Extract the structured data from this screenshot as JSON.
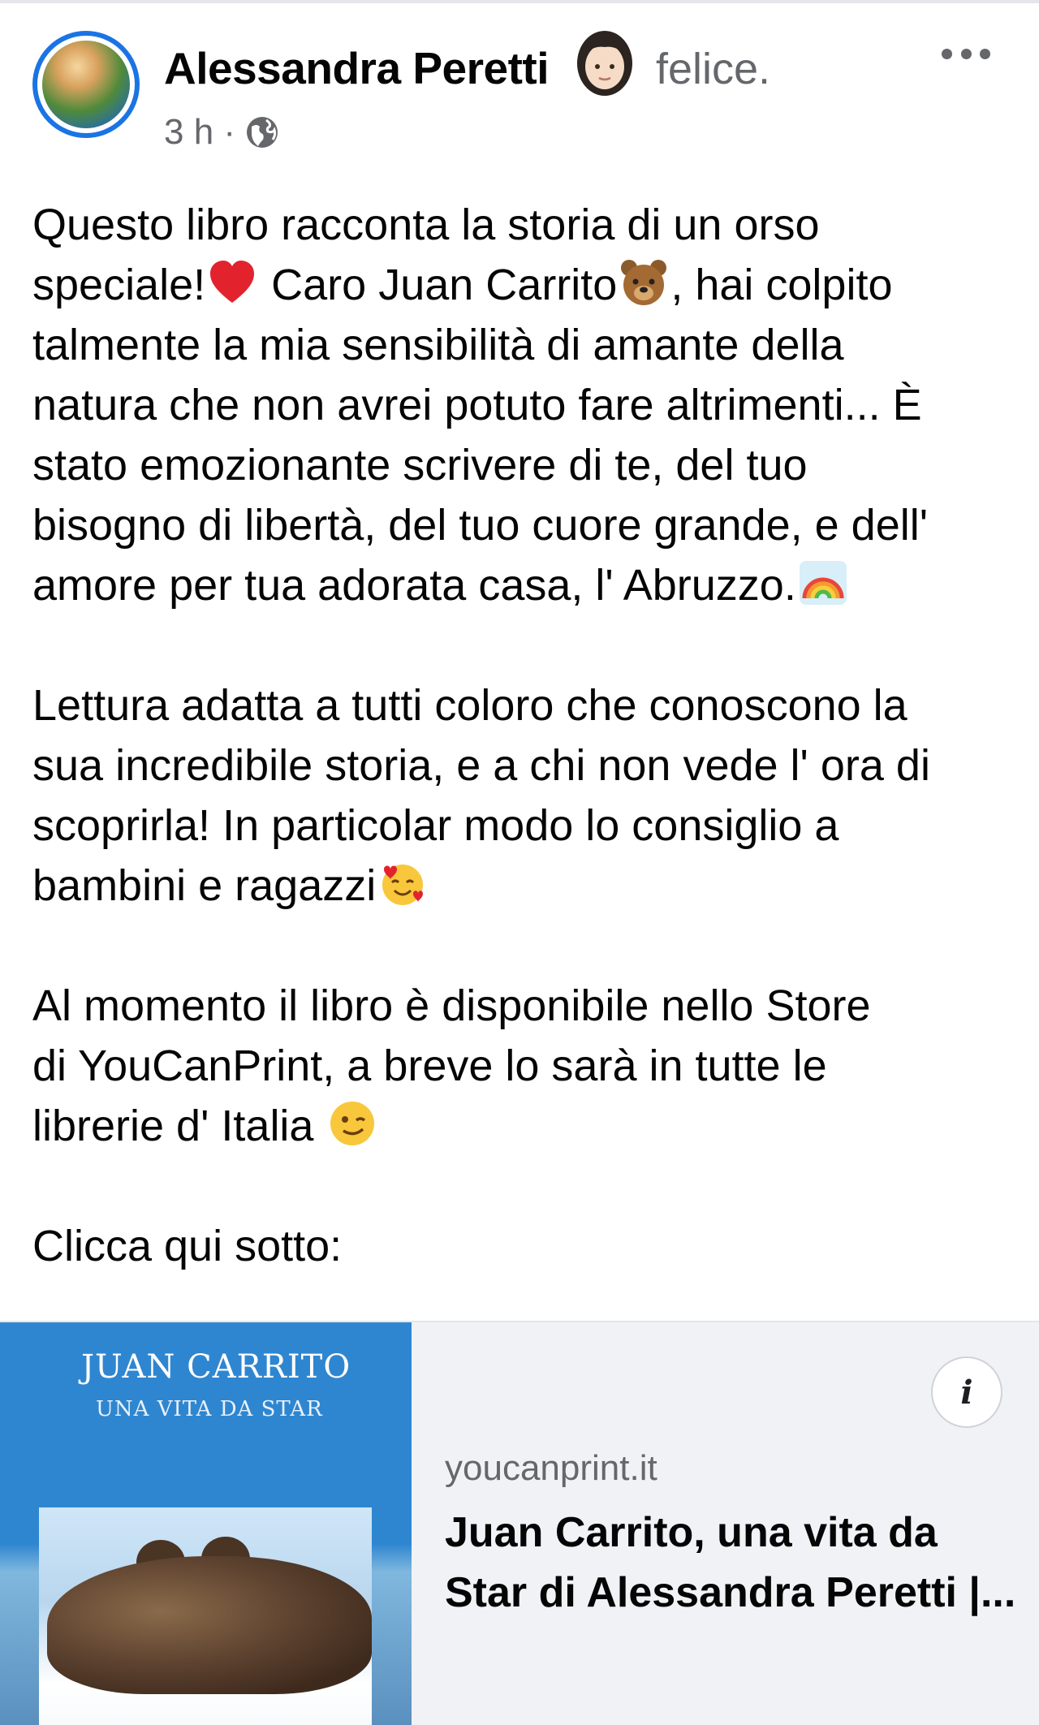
{
  "post": {
    "author_name": "Alessandra Peretti",
    "feeling": "felice.",
    "time": "3 h ·",
    "body": {
      "p1": [
        "Questo libro racconta la storia di un orso",
        "speciale!",
        " Caro Juan Carrito",
        ", hai colpito",
        "talmente la mia sensibilità di amante della",
        "natura che non avrei potuto fare altrimenti... È",
        "stato emozionante scrivere di te, del tuo",
        "bisogno di libertà, del tuo cuore grande, e dell'",
        "amore per tua adorata casa, l' Abruzzo."
      ],
      "p2": [
        "Lettura adatta a tutti coloro che conoscono la",
        "sua incredibile storia, e a chi non vede l' ora di",
        "scoprirla! In particolar modo lo consiglio a",
        "bambini e ragazzi"
      ],
      "p3": [
        "Al momento il libro è disponibile nello Store",
        "di YouCanPrint, a breve lo sarà in tutte le",
        "librerie d' Italia "
      ],
      "p4": "Clicca qui sotto:"
    }
  },
  "link_preview": {
    "book_title": "JUAN CARRITO",
    "book_subtitle": "UNA VITA DA STAR",
    "domain": "youcanprint.it",
    "title_line1": "Juan Carrito, una vita da",
    "title_line2": "Star di Alessandra Peretti |..."
  },
  "icons": {
    "more": "more-options-icon",
    "privacy": "globe-icon",
    "info": "info-icon"
  },
  "colors": {
    "avatar_ring": "#1b74e4",
    "secondary_text": "#65676b",
    "preview_bg": "#f0f2f5",
    "book_blue": "#2f86d0"
  }
}
